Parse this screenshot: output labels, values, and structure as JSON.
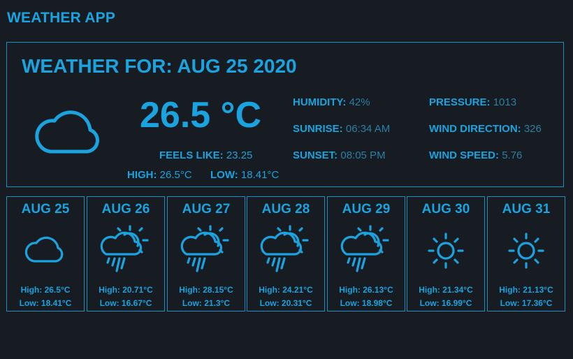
{
  "app": {
    "title": "WEATHER APP"
  },
  "current": {
    "heading": "WEATHER FOR: AUG 25 2020",
    "icon": "cloud-icon",
    "temperature": "26.5 °C",
    "feels_like_label": "FEELS LIKE:",
    "feels_like_value": "23.25",
    "high_label": "HIGH:",
    "high_value": "26.5°C",
    "low_label": "LOW:",
    "low_value": "18.41°C",
    "humidity_label": "HUMIDITY:",
    "humidity_value": "42%",
    "sunrise_label": "SUNRISE:",
    "sunrise_value": "06:34 AM",
    "sunset_label": "SUNSET:",
    "sunset_value": "08:05 PM",
    "pressure_label": "PRESSURE:",
    "pressure_value": "1013",
    "wind_direction_label": "WIND DIRECTION:",
    "wind_direction_value": "326",
    "wind_speed_label": "WIND SPEED:",
    "wind_speed_value": "5.76"
  },
  "forecast": [
    {
      "day": "AUG 25",
      "icon": "cloud-icon",
      "high": "High: 26.5°C",
      "low": "Low: 18.41°C"
    },
    {
      "day": "AUG 26",
      "icon": "sun-cloud-rain-icon",
      "high": "High: 20.71°C",
      "low": "Low: 16.67°C"
    },
    {
      "day": "AUG 27",
      "icon": "sun-cloud-rain-icon",
      "high": "High: 28.15°C",
      "low": "Low: 21.3°C"
    },
    {
      "day": "AUG 28",
      "icon": "sun-cloud-rain-icon",
      "high": "High: 24.21°C",
      "low": "Low: 20.31°C"
    },
    {
      "day": "AUG 29",
      "icon": "sun-cloud-rain-icon",
      "high": "High: 26.13°C",
      "low": "Low: 18.98°C"
    },
    {
      "day": "AUG 30",
      "icon": "sun-icon",
      "high": "High: 21.34°C",
      "low": "Low: 16.99°C"
    },
    {
      "day": "AUG 31",
      "icon": "sun-icon",
      "high": "High: 21.13°C",
      "low": "Low: 17.36°C"
    }
  ],
  "colors": {
    "background": "#171b22",
    "accent": "#1aa3de",
    "muted_value": "#2b7fa6"
  }
}
